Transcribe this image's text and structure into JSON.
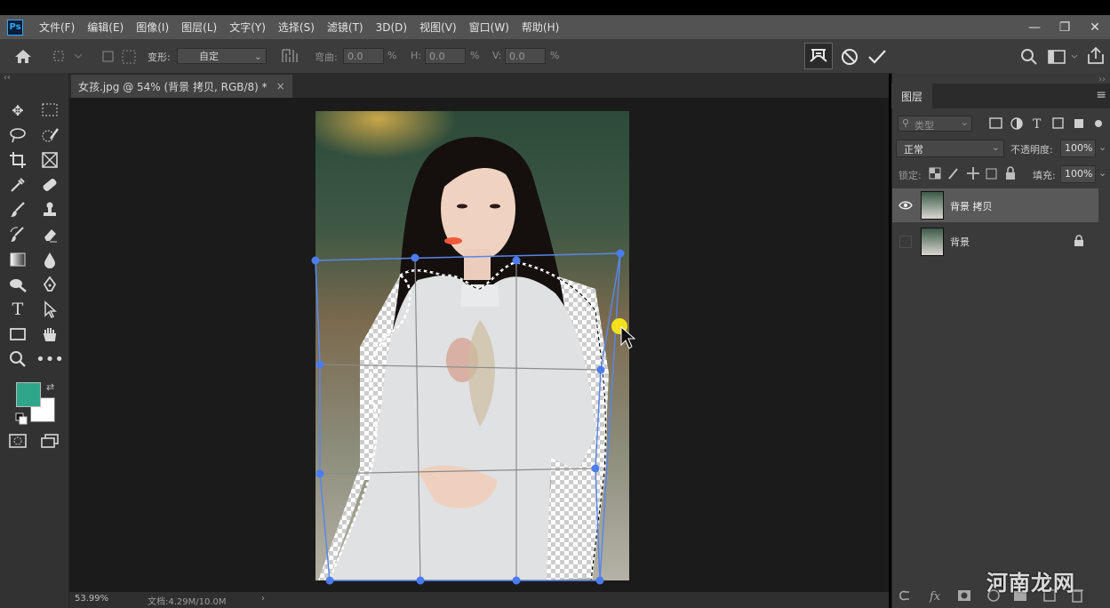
{
  "app": {
    "logo": "Ps",
    "menu": [
      "文件(F)",
      "编辑(E)",
      "图像(I)",
      "图层(L)",
      "文字(Y)",
      "选择(S)",
      "滤镜(T)",
      "3D(D)",
      "视图(V)",
      "窗口(W)",
      "帮助(H)"
    ],
    "window_controls": [
      "—",
      "❐",
      "✕"
    ]
  },
  "options": {
    "transform_label": "变形:",
    "transform_value": "自定",
    "bend_label": "弯曲:",
    "bend_value": "0.0",
    "h_label": "H:",
    "h_value": "0.0",
    "v_label": "V:",
    "v_value": "0.0",
    "pct": "%"
  },
  "document": {
    "tab_title": "女孩.jpg @ 54% (背景 拷贝, RGB/8) *",
    "close": "×",
    "zoom": "53.99%",
    "doc_size": "文档:4.29M/10.0M",
    "status_arrow": "›"
  },
  "layers_panel": {
    "tab": "图层",
    "menu_icon": "≡",
    "filter_placeholder": "类型",
    "blend_mode": "正常",
    "opacity_label": "不透明度:",
    "opacity_value": "100%",
    "lock_label": "锁定:",
    "fill_label": "填充:",
    "fill_value": "100%",
    "layers": [
      {
        "name": "背景 拷贝",
        "visible": true,
        "selected": true
      },
      {
        "name": "背景",
        "visible": false,
        "selected": false,
        "locked": true
      }
    ]
  },
  "colors": {
    "foreground": "#2fa58a",
    "background": "#ffffff",
    "handle": "#4d7cf0",
    "cursor_highlight": "#f5e11b"
  },
  "watermark": "河南龙网"
}
